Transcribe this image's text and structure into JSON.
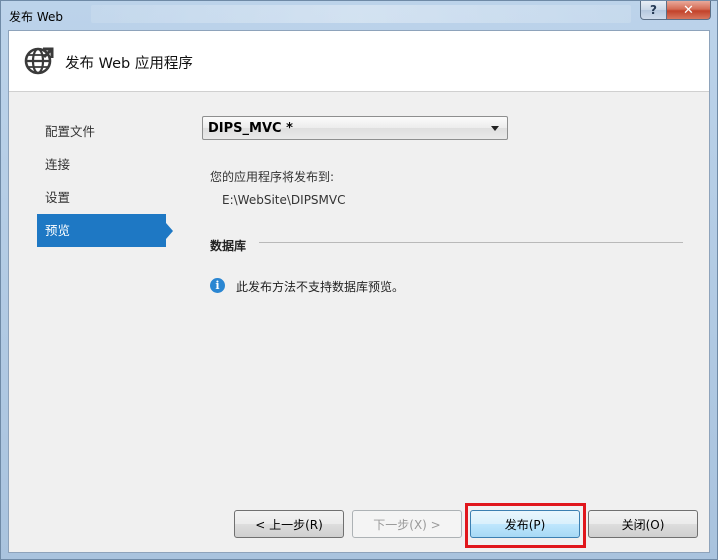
{
  "window": {
    "title": "发布 Web",
    "help_glyph": "?",
    "close_glyph": "✕"
  },
  "header": {
    "title": "发布 Web 应用程序",
    "icon": "globe-publish-icon"
  },
  "nav": {
    "items": [
      "配置文件",
      "连接",
      "设置",
      "预览"
    ],
    "selected": "预览"
  },
  "profile": {
    "selected": "DIPS_MVC *"
  },
  "content": {
    "publish_label": "您的应用程序将发布到:",
    "publish_path": "E:\\WebSite\\DIPSMVC",
    "database_heading": "数据库",
    "info_glyph": "i",
    "info_message": "此发布方法不支持数据库预览。"
  },
  "buttons": {
    "prev": "< 上一步(R)",
    "next": "下一步(X) >",
    "publish": "发布(P)",
    "close": "关闭(O)"
  },
  "colors": {
    "accent": "#1e78c4",
    "highlight": "#e0161c",
    "info": "#2a86d2"
  }
}
